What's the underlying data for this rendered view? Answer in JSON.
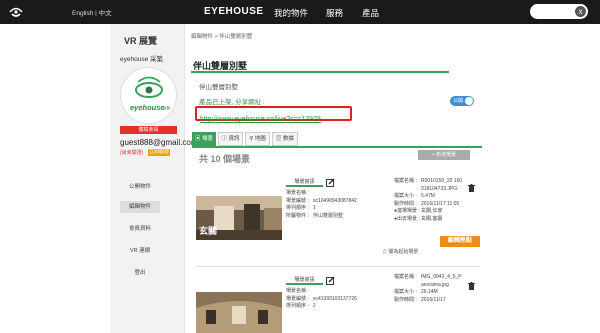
{
  "header": {
    "lang": "English | 中文",
    "brand": "EYEHOUSE",
    "nav": [
      "我的物件",
      "服務",
      "產品"
    ],
    "search_clear": "x"
  },
  "sidebar": {
    "title": "VR 展覽",
    "username": "eyehouse 采築",
    "logo_text": "eyehouse",
    "logo_vr": "VR",
    "badge": "體驗會員",
    "email": "guest888@gmail.com",
    "unverified": "(尚未驗證)",
    "verify_button": "立即驗證",
    "menu": [
      "公開物件",
      "編輯物件",
      "會員資料",
      "VR 連線",
      "登出"
    ]
  },
  "main": {
    "breadcrumb": "編輯物件  >  伴山雙層別墅",
    "title": "伴山雙層別墅",
    "subtitle": "伴山雙層別墅",
    "published_text": "產品已上架, 分享網址 :",
    "toggle_label": "公開",
    "share_url": "http://www.eyehouse.co/live?c=c17979",
    "tabs": [
      "場景",
      "資訊",
      "地圖",
      "數據"
    ],
    "scene_count": "共 10 個場景",
    "add_scene": "+ 新增場景",
    "scenes": [
      {
        "info_tab": "場景資訊",
        "fields": [
          {
            "k": "場景名稱 :",
            "v": ""
          },
          {
            "k": "場景編號 :",
            "v": "sc10490943087842"
          },
          {
            "k": "排列順序 :",
            "v": "1"
          },
          {
            "k": "所屬物件 :",
            "v": "伴山雙層別墅"
          }
        ],
        "file_fields": [
          {
            "k": "檔案名稱 :",
            "v": "R0010159_20 160318104733.JPG"
          },
          {
            "k": "檔案大小 :",
            "v": "5.47M"
          },
          {
            "k": "製作時間 :",
            "v": "2016/11/17 11:05"
          },
          {
            "k": "●進場場景 :",
            "v": "玄關,伝家"
          },
          {
            "k": "●出去場景 :",
            "v": "玄關,客廳"
          }
        ],
        "thumb_label": "玄關",
        "set_start": "☆ 優為起始場景",
        "edit_points": "編輯熱點"
      },
      {
        "info_tab": "場景資訊",
        "fields": [
          {
            "k": "場景名稱 :",
            "v": ""
          },
          {
            "k": "場景編號 :",
            "v": "sc41393103137726"
          },
          {
            "k": "排列順序 :",
            "v": "2"
          }
        ],
        "file_fields": [
          {
            "k": "檔案名稱 :",
            "v": "IMG_6043_4_5_Panorama.jpg"
          },
          {
            "k": "檔案大小 :",
            "v": "26.14M"
          },
          {
            "k": "製作時間 :",
            "v": "2016/11/17"
          }
        ]
      }
    ]
  },
  "colors": {
    "accent": "#3aa05a",
    "url_border": "#e02020",
    "orange": "#f08a1a",
    "toggle": "#3a8fd8"
  }
}
